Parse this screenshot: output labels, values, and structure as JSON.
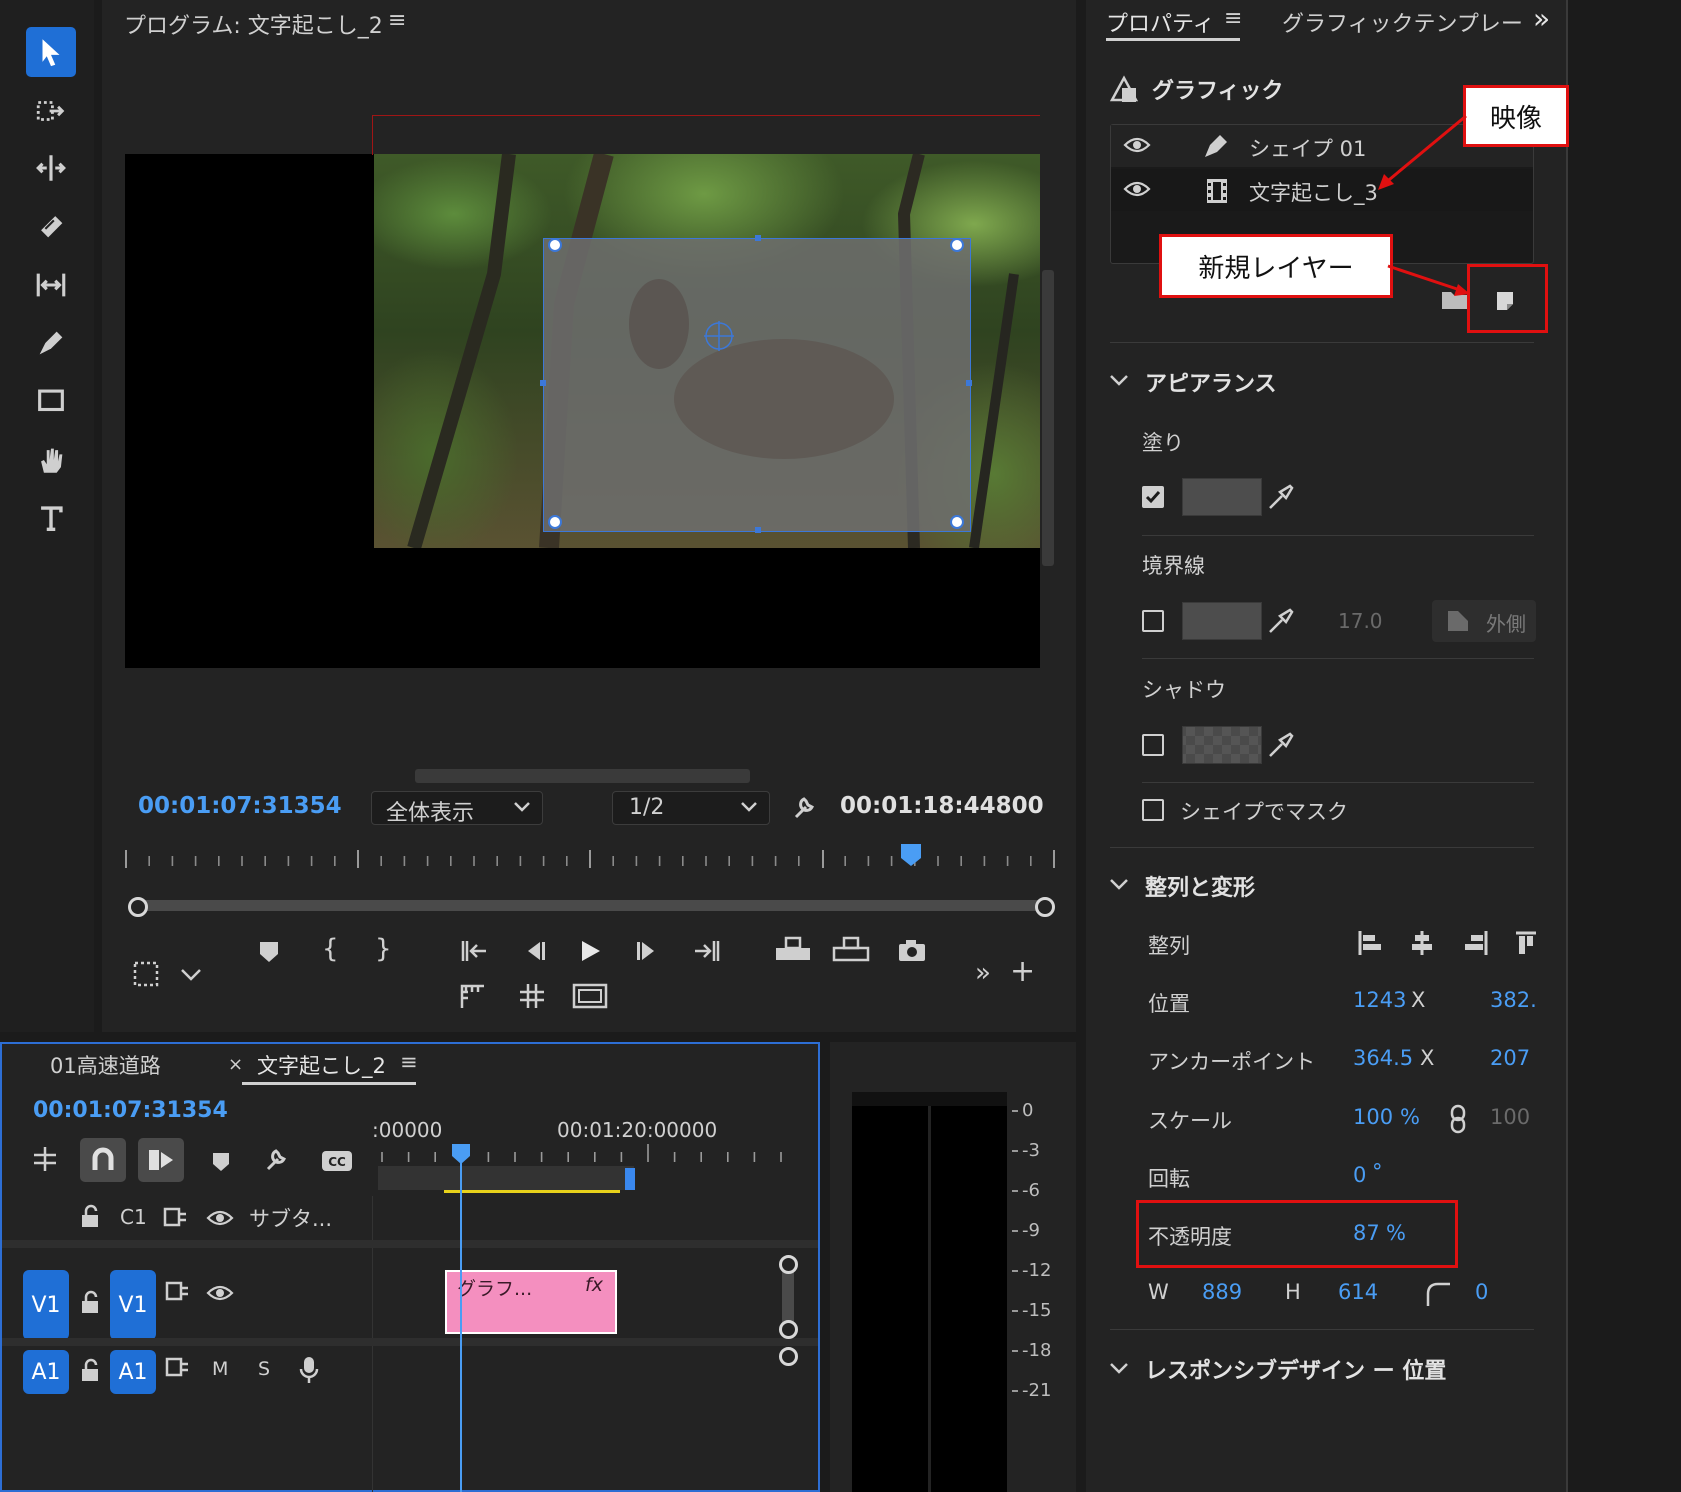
{
  "program_monitor": {
    "title": "プログラム: 文字起こし_2",
    "current_time": "00:01:07:31354",
    "zoom": "全体表示",
    "resolution": "1/2",
    "duration": "00:01:18:44800"
  },
  "properties": {
    "tabs": [
      "プロパティ",
      "グラフィックテンプレー"
    ],
    "section_graphic": "グラフィック",
    "layers": [
      {
        "name": "シェイプ 01",
        "icon": "pen-icon"
      },
      {
        "name": "文字起こし_3",
        "icon": "film-icon"
      }
    ],
    "appearance": {
      "header": "アピアランス",
      "fill_label": "塗り",
      "stroke_label": "境界線",
      "stroke_width": "17.0",
      "stroke_position": "外側",
      "shadow_label": "シャドウ",
      "mask_label": "シェイプでマスク"
    },
    "align_transform": {
      "header": "整列と変形",
      "align_label": "整列",
      "position_label": "位置",
      "position_x": "1243",
      "position_y": "382.",
      "anchor_label": "アンカーポイント",
      "anchor_x": "364.5",
      "anchor_y": "207",
      "scale_label": "スケール",
      "scale_value": "100",
      "scale_unit": "%",
      "scale_linked": "100",
      "rotation_label": "回転",
      "rotation_value": "0",
      "rotation_unit": "°",
      "opacity_label": "不透明度",
      "opacity_value": "87",
      "opacity_unit": "%",
      "w_label": "W",
      "w_value": "889",
      "h_label": "H",
      "h_value": "614",
      "corner_value": "0",
      "x_label": "X"
    },
    "responsive_header": "レスポンシブデザイン ー 位置"
  },
  "callouts": {
    "video": "映像",
    "new_layer": "新規レイヤー"
  },
  "timeline": {
    "tabs": [
      "01高速道路",
      "文字起こし_2"
    ],
    "close_mark": "×",
    "current_time": "00:01:07:31354",
    "ruler_left": ":00000",
    "ruler_right": "00:01:20:00000",
    "caption_track": {
      "id": "C1",
      "name": "サブタ..."
    },
    "video_track": {
      "source": "V1",
      "target": "V1"
    },
    "audio_track": {
      "source": "A1",
      "target": "A1",
      "mute": "M",
      "solo": "S"
    },
    "clip_name": "グラフ...",
    "clip_fx": "fx"
  },
  "audio_meter": {
    "ticks": [
      "0",
      "-3",
      "-6",
      "-9",
      "-12",
      "-15",
      "-18",
      "-21"
    ]
  },
  "colors": {
    "accent_blue": "#1f6fd6",
    "timecode_blue": "#4a9df4",
    "clip_pink": "#f48fbf",
    "callout_red": "#e01010"
  }
}
